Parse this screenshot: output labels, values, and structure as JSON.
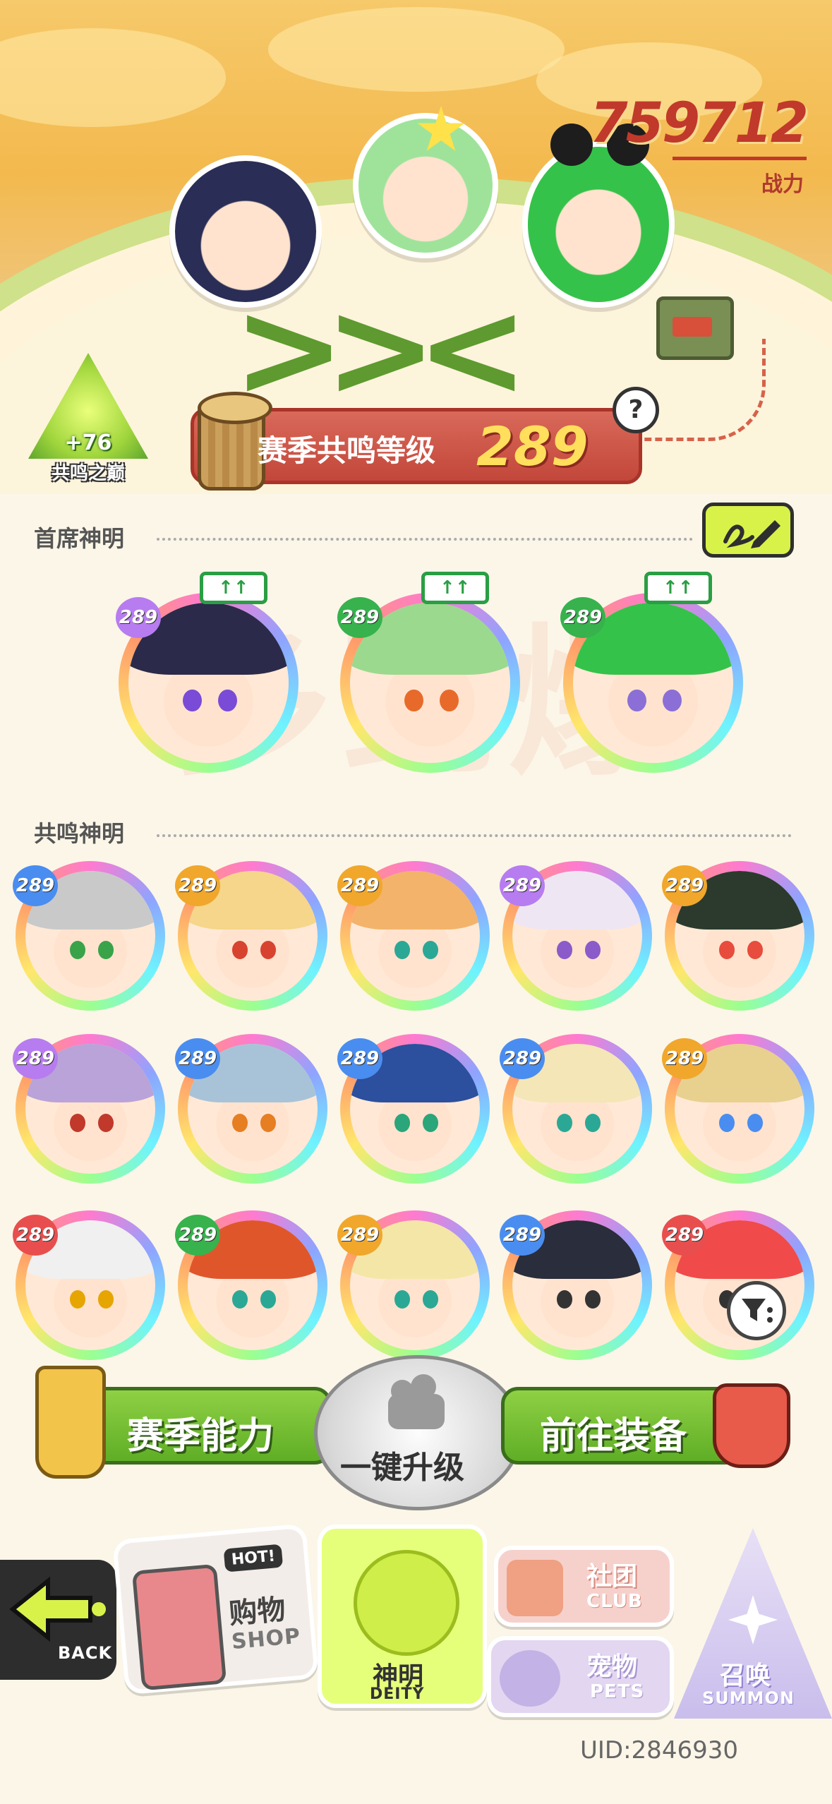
{
  "header": {
    "power_value": "759712",
    "power_label": "战力"
  },
  "resonance_badge": {
    "plus": "+76",
    "label": "共鸣之巅"
  },
  "season_banner": {
    "label": "赛季共鸣等级",
    "level": "289",
    "help": "?"
  },
  "sections": {
    "chief": "首席神明",
    "resonance": "共鸣神明"
  },
  "watermark": "多到爆",
  "chief_gods": [
    {
      "level": "289",
      "upgrade": "↑↑",
      "hair": "#2b2a4a",
      "eye": "#7a4bd6",
      "badge": "#b77cf0"
    },
    {
      "level": "289",
      "upgrade": "↑↑",
      "hair": "#9bd98e",
      "eye": "#e86a2a",
      "badge": "#37b24d"
    },
    {
      "level": "289",
      "upgrade": "↑↑",
      "hair": "#35c24a",
      "eye": "#8b6fd6",
      "badge": "#37b24d"
    }
  ],
  "resonance_gods": [
    {
      "level": "289",
      "hair": "#c9c9c9",
      "eye": "#39a34a",
      "badge": "#4a8df0"
    },
    {
      "level": "289",
      "hair": "#f5d68a",
      "eye": "#d8432f",
      "badge": "#f0a72b"
    },
    {
      "level": "289",
      "hair": "#f3b36a",
      "eye": "#2aa895",
      "badge": "#f0a72b"
    },
    {
      "level": "289",
      "hair": "#efe6f3",
      "eye": "#8a5bc9",
      "badge": "#b77cf0"
    },
    {
      "level": "289",
      "hair": "#2b3a2d",
      "eye": "#e74c3c",
      "badge": "#f0a72b"
    },
    {
      "level": "289",
      "hair": "#b9a3d8",
      "eye": "#c0392b",
      "badge": "#b77cf0"
    },
    {
      "level": "289",
      "hair": "#a8c3d8",
      "eye": "#e67e22",
      "badge": "#4a8df0"
    },
    {
      "level": "289",
      "hair": "#2c4f9e",
      "eye": "#2ba57a",
      "badge": "#4a8df0"
    },
    {
      "level": "289",
      "hair": "#f4e6b6",
      "eye": "#2aa895",
      "badge": "#4a8df0"
    },
    {
      "level": "289",
      "hair": "#e8d08f",
      "eye": "#4a8df0",
      "badge": "#f0a72b"
    },
    {
      "level": "289",
      "hair": "#f0f0f0",
      "eye": "#e6a500",
      "badge": "#e84e4e"
    },
    {
      "level": "289",
      "hair": "#e0562b",
      "eye": "#2aa895",
      "badge": "#37b24d"
    },
    {
      "level": "289",
      "hair": "#f4e6a6",
      "eye": "#2aa895",
      "badge": "#f0a72b"
    },
    {
      "level": "289",
      "hair": "#2a2d3b",
      "eye": "#333333",
      "badge": "#4a8df0"
    },
    {
      "level": "289",
      "hair": "#f04a4a",
      "eye": "#333333",
      "badge": "#e84e4e"
    }
  ],
  "actions": {
    "season_ability": "赛季能力",
    "one_key_upgrade": "一键升级",
    "goto_equip": "前往装备"
  },
  "nav": {
    "back": "BACK",
    "shop_hot": "HOT!",
    "shop_cn": "购物",
    "shop_en": "SHOP",
    "deity_cn": "神明",
    "deity_en": "DEITY",
    "club_cn": "社团",
    "club_en": "CLUB",
    "pets_cn": "宠物",
    "pets_en": "PETS",
    "summon_cn": "召唤",
    "summon_en": "SUMMON"
  },
  "uid": "UID:2846930"
}
